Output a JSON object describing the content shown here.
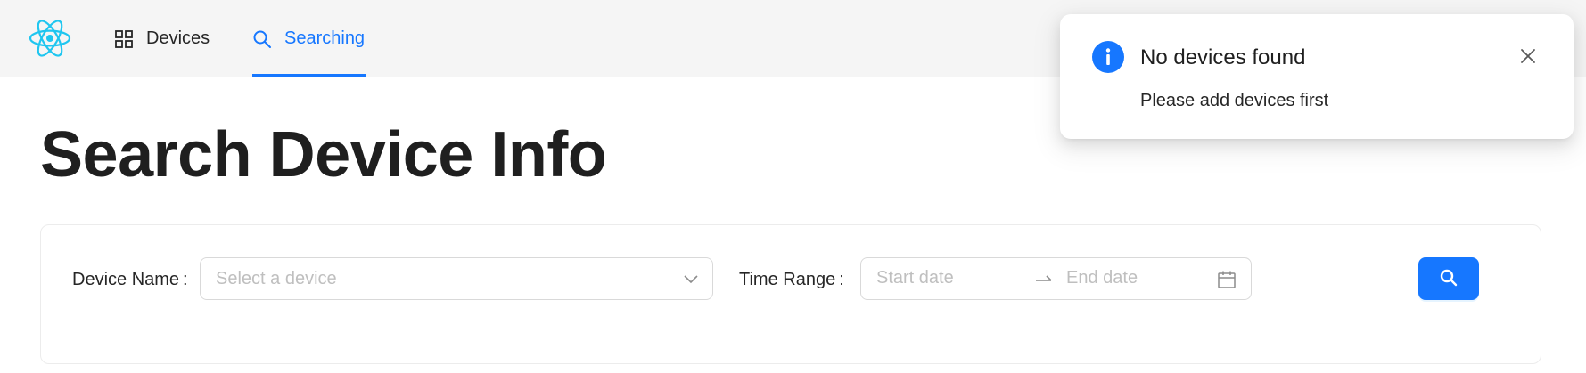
{
  "header": {
    "logo_icon": "react-logo-icon",
    "nav": [
      {
        "label": "Devices",
        "icon": "appstore-grid-icon",
        "active": false
      },
      {
        "label": "Searching",
        "icon": "search-icon",
        "active": true
      }
    ]
  },
  "main": {
    "title": "Search Device Info",
    "form": {
      "device_label": "Device Name",
      "device_placeholder": "Select a device",
      "time_label": "Time Range",
      "start_placeholder": "Start date",
      "end_placeholder": "End date",
      "submit_icon": "search-icon"
    }
  },
  "notification": {
    "title": "No devices found",
    "description": "Please add devices first",
    "icon": "info-circle-icon"
  },
  "colors": {
    "primary": "#1677ff",
    "react_logo": "#1fc6f0",
    "header_bg": "#f5f5f5"
  }
}
